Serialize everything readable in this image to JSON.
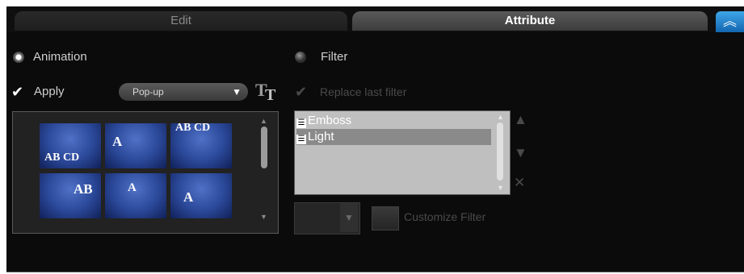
{
  "tabs": {
    "edit": "Edit",
    "attribute": "Attribute",
    "collapse_icon": "chevrons-up-icon"
  },
  "animation": {
    "radio_label": "Animation",
    "selected": true,
    "apply_label": "Apply",
    "apply_checked": true,
    "preset_value": "Pop-up",
    "title_icon": "text-style-icon",
    "thumbnails": [
      "AB CD",
      "A",
      "AB CD",
      "AB",
      "A",
      "A"
    ]
  },
  "filter": {
    "radio_label": "Filter",
    "selected": false,
    "replace_label": "Replace last filter",
    "replace_checked": true,
    "items": [
      "Emboss",
      "Light"
    ],
    "selected_item": "Light",
    "customize_label": "Customize Filter"
  }
}
